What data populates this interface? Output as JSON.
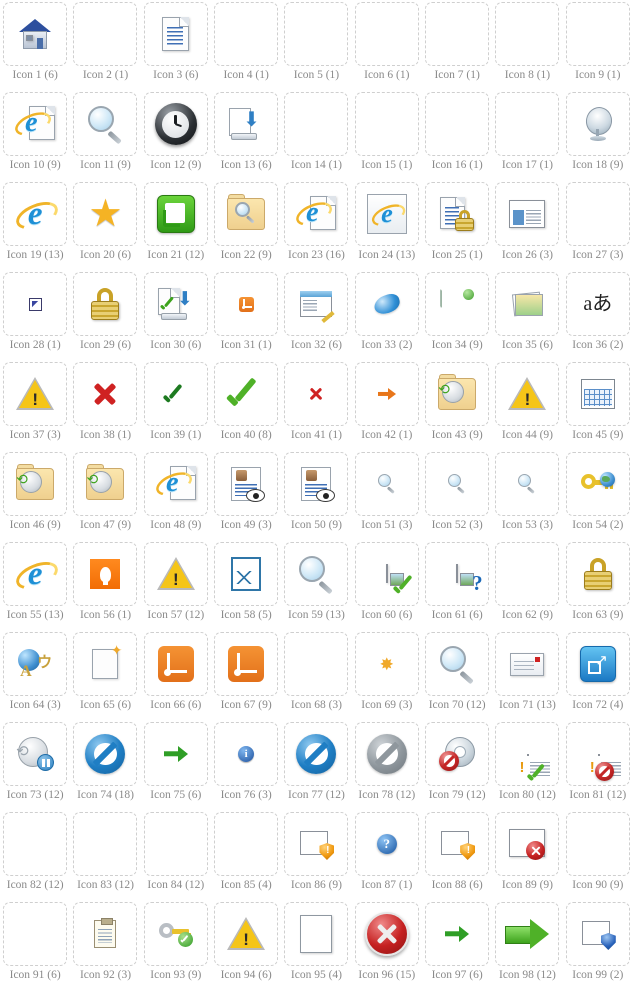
{
  "page": {
    "title": "Icon Grid",
    "columns": 9,
    "rows": 11,
    "total_cells": 99,
    "label_color": "#8a8a8a",
    "tile_border_color": "#cfcfcf",
    "background": "#ffffff"
  },
  "icons": [
    {
      "n": 1,
      "label": "Icon 1 (6)",
      "count": 6,
      "glyph": "house-icon",
      "empty": false
    },
    {
      "n": 2,
      "label": "Icon 2 (1)",
      "count": 1,
      "glyph": "empty",
      "empty": true
    },
    {
      "n": 3,
      "label": "Icon 3 (6)",
      "count": 6,
      "glyph": "document-icon",
      "empty": false
    },
    {
      "n": 4,
      "label": "Icon 4 (1)",
      "count": 1,
      "glyph": "empty",
      "empty": true
    },
    {
      "n": 5,
      "label": "Icon 5 (1)",
      "count": 1,
      "glyph": "empty",
      "empty": true
    },
    {
      "n": 6,
      "label": "Icon 6 (1)",
      "count": 1,
      "glyph": "empty",
      "empty": true
    },
    {
      "n": 7,
      "label": "Icon 7 (1)",
      "count": 1,
      "glyph": "empty",
      "empty": true
    },
    {
      "n": 8,
      "label": "Icon 8 (1)",
      "count": 1,
      "glyph": "empty",
      "empty": true
    },
    {
      "n": 9,
      "label": "Icon 9 (1)",
      "count": 1,
      "glyph": "empty",
      "empty": true
    },
    {
      "n": 10,
      "label": "Icon 10 (9)",
      "count": 9,
      "glyph": "ie-page-icon",
      "empty": false
    },
    {
      "n": 11,
      "label": "Icon 11 (9)",
      "count": 9,
      "glyph": "magnifier-icon",
      "empty": false
    },
    {
      "n": 12,
      "label": "Icon 12 (9)",
      "count": 9,
      "glyph": "dark-clock-icon",
      "empty": false
    },
    {
      "n": 13,
      "label": "Icon 13 (6)",
      "count": 6,
      "glyph": "download-drive-icon",
      "empty": false
    },
    {
      "n": 14,
      "label": "Icon 14 (1)",
      "count": 1,
      "glyph": "empty",
      "empty": true
    },
    {
      "n": 15,
      "label": "Icon 15 (1)",
      "count": 1,
      "glyph": "empty",
      "empty": true
    },
    {
      "n": 16,
      "label": "Icon 16 (1)",
      "count": 1,
      "glyph": "empty",
      "empty": true
    },
    {
      "n": 17,
      "label": "Icon 17 (1)",
      "count": 1,
      "glyph": "empty",
      "empty": true
    },
    {
      "n": 18,
      "label": "Icon 18 (9)",
      "count": 9,
      "glyph": "satellite-dish-icon",
      "empty": false
    },
    {
      "n": 19,
      "label": "Icon 19 (13)",
      "count": 13,
      "glyph": "ie-logo-icon",
      "empty": false
    },
    {
      "n": 20,
      "label": "Icon 20 (6)",
      "count": 6,
      "glyph": "star-icon",
      "empty": false
    },
    {
      "n": 21,
      "label": "Icon 21 (12)",
      "count": 12,
      "glyph": "green-rss-box-icon",
      "empty": false
    },
    {
      "n": 22,
      "label": "Icon 22 (9)",
      "count": 9,
      "glyph": "folder-search-icon",
      "empty": false
    },
    {
      "n": 23,
      "label": "Icon 23 (16)",
      "count": 16,
      "glyph": "ie-page-icon",
      "empty": false
    },
    {
      "n": 24,
      "label": "Icon 24 (13)",
      "count": 13,
      "glyph": "ie-framed-icon",
      "empty": false
    },
    {
      "n": 25,
      "label": "Icon 25 (1)",
      "count": 1,
      "glyph": "document-lock-icon",
      "empty": false
    },
    {
      "n": 26,
      "label": "Icon 26 (3)",
      "count": 3,
      "glyph": "window-pane-icon",
      "empty": false
    },
    {
      "n": 27,
      "label": "Icon 27 (3)",
      "count": 3,
      "glyph": "red-shield-question-icon",
      "empty": false
    },
    {
      "n": 28,
      "label": "Icon 28 (1)",
      "count": 1,
      "glyph": "tiny-square-icon",
      "empty": false
    },
    {
      "n": 29,
      "label": "Icon 29 (6)",
      "count": 6,
      "glyph": "padlock-icon",
      "empty": false
    },
    {
      "n": 30,
      "label": "Icon 30 (6)",
      "count": 6,
      "glyph": "document-download-check-icon",
      "empty": false
    },
    {
      "n": 31,
      "label": "Icon 31 (1)",
      "count": 1,
      "glyph": "rss-small-icon",
      "empty": false
    },
    {
      "n": 32,
      "label": "Icon 32 (6)",
      "count": 6,
      "glyph": "window-edit-icon",
      "empty": false
    },
    {
      "n": 33,
      "label": "Icon 33 (2)",
      "count": 2,
      "glyph": "blue-blob-icon",
      "empty": false
    },
    {
      "n": 34,
      "label": "Icon 34 (9)",
      "count": 9,
      "glyph": "map-pin-icon",
      "empty": false
    },
    {
      "n": 35,
      "label": "Icon 35 (6)",
      "count": 6,
      "glyph": "photo-stack-icon",
      "empty": false
    },
    {
      "n": 36,
      "label": "Icon 36 (2)",
      "count": 2,
      "glyph": "language-icon",
      "empty": false
    },
    {
      "n": 37,
      "label": "Icon 37 (3)",
      "count": 3,
      "glyph": "warning-triangle-icon",
      "empty": false
    },
    {
      "n": 38,
      "label": "Icon 38 (1)",
      "count": 1,
      "glyph": "red-x-icon",
      "empty": false
    },
    {
      "n": 39,
      "label": "Icon 39 (1)",
      "count": 1,
      "glyph": "dark-green-check-icon",
      "empty": false
    },
    {
      "n": 40,
      "label": "Icon 40 (8)",
      "count": 8,
      "glyph": "green-check-icon",
      "empty": false
    },
    {
      "n": 41,
      "label": "Icon 41 (1)",
      "count": 1,
      "glyph": "small-red-x-icon",
      "empty": false
    },
    {
      "n": 42,
      "label": "Icon 42 (1)",
      "count": 1,
      "glyph": "orange-arrow-icon",
      "empty": false
    },
    {
      "n": 43,
      "label": "Icon 43 (9)",
      "count": 9,
      "glyph": "folder-history-icon",
      "empty": false
    },
    {
      "n": 44,
      "label": "Icon 44 (9)",
      "count": 9,
      "glyph": "warning-triangle-icon",
      "empty": false
    },
    {
      "n": 45,
      "label": "Icon 45 (9)",
      "count": 9,
      "glyph": "calendar-icon",
      "empty": false
    },
    {
      "n": 46,
      "label": "Icon 46 (9)",
      "count": 9,
      "glyph": "folder-restore-icon",
      "empty": false
    },
    {
      "n": 47,
      "label": "Icon 47 (9)",
      "count": 9,
      "glyph": "folder-restore-icon",
      "empty": false
    },
    {
      "n": 48,
      "label": "Icon 48 (9)",
      "count": 9,
      "glyph": "ie-page-icon",
      "empty": false
    },
    {
      "n": 49,
      "label": "Icon 49 (3)",
      "count": 3,
      "glyph": "person-doc-eye-icon",
      "empty": false
    },
    {
      "n": 50,
      "label": "Icon 50 (9)",
      "count": 9,
      "glyph": "person-doc-eye-icon",
      "empty": false
    },
    {
      "n": 51,
      "label": "Icon 51 (3)",
      "count": 3,
      "glyph": "small-magnifier-icon",
      "empty": false
    },
    {
      "n": 52,
      "label": "Icon 52 (3)",
      "count": 3,
      "glyph": "small-magnifier-icon",
      "empty": false
    },
    {
      "n": 53,
      "label": "Icon 53 (3)",
      "count": 3,
      "glyph": "small-magnifier-icon",
      "empty": false
    },
    {
      "n": 54,
      "label": "Icon 54 (2)",
      "count": 2,
      "glyph": "key-globe-icon",
      "empty": false
    },
    {
      "n": 55,
      "label": "Icon 55 (13)",
      "count": 13,
      "glyph": "ie-logo-icon",
      "empty": false
    },
    {
      "n": 56,
      "label": "Icon 56 (1)",
      "count": 1,
      "glyph": "orange-bulb-icon",
      "empty": false
    },
    {
      "n": 57,
      "label": "Icon 57 (12)",
      "count": 12,
      "glyph": "warning-triangle-icon",
      "empty": false
    },
    {
      "n": 58,
      "label": "Icon 58 (5)",
      "count": 5,
      "glyph": "broken-image-icon",
      "empty": false
    },
    {
      "n": 59,
      "label": "Icon 59 (13)",
      "count": 13,
      "glyph": "magnifier-icon",
      "empty": false
    },
    {
      "n": 60,
      "label": "Icon 60 (6)",
      "count": 6,
      "glyph": "window-check-icon",
      "empty": false
    },
    {
      "n": 61,
      "label": "Icon 61 (6)",
      "count": 6,
      "glyph": "window-question-icon",
      "empty": false
    },
    {
      "n": 62,
      "label": "Icon 62 (9)",
      "count": 9,
      "glyph": "red-shield-x-icon",
      "empty": false
    },
    {
      "n": 63,
      "label": "Icon 63 (9)",
      "count": 9,
      "glyph": "padlock-icon",
      "empty": false
    },
    {
      "n": 64,
      "label": "Icon 64 (3)",
      "count": 3,
      "glyph": "globe-language-icon",
      "empty": false
    },
    {
      "n": 65,
      "label": "Icon 65 (6)",
      "count": 6,
      "glyph": "new-page-icon",
      "empty": false
    },
    {
      "n": 66,
      "label": "Icon 66 (6)",
      "count": 6,
      "glyph": "rss-icon",
      "empty": false
    },
    {
      "n": 67,
      "label": "Icon 67 (9)",
      "count": 9,
      "glyph": "rss-icon",
      "empty": false
    },
    {
      "n": 68,
      "label": "Icon 68 (3)",
      "count": 3,
      "glyph": "cascade-windows-icon",
      "empty": false
    },
    {
      "n": 69,
      "label": "Icon 69 (3)",
      "count": 3,
      "glyph": "spark-icon",
      "empty": false
    },
    {
      "n": 70,
      "label": "Icon 70 (12)",
      "count": 12,
      "glyph": "magnifier-icon",
      "empty": false
    },
    {
      "n": 71,
      "label": "Icon 71 (13)",
      "count": 13,
      "glyph": "envelope-icon",
      "empty": false
    },
    {
      "n": 72,
      "label": "Icon 72 (4)",
      "count": 4,
      "glyph": "blue-external-link-icon",
      "empty": false
    },
    {
      "n": 73,
      "label": "Icon 73 (12)",
      "count": 12,
      "glyph": "clock-pause-icon",
      "empty": false
    },
    {
      "n": 74,
      "label": "Icon 74 (18)",
      "count": 18,
      "glyph": "blue-ban-icon",
      "empty": false
    },
    {
      "n": 75,
      "label": "Icon 75 (6)",
      "count": 6,
      "glyph": "green-arrow-icon",
      "empty": false
    },
    {
      "n": 76,
      "label": "Icon 76 (3)",
      "count": 3,
      "glyph": "info-icon",
      "empty": false
    },
    {
      "n": 77,
      "label": "Icon 77 (12)",
      "count": 12,
      "glyph": "blue-ban-icon",
      "empty": false
    },
    {
      "n": 78,
      "label": "Icon 78 (12)",
      "count": 12,
      "glyph": "gray-ban-icon",
      "empty": false
    },
    {
      "n": 79,
      "label": "Icon 79 (12)",
      "count": 12,
      "glyph": "gear-ban-icon",
      "empty": false
    },
    {
      "n": 80,
      "label": "Icon 80 (12)",
      "count": 12,
      "glyph": "window-check-bang-icon",
      "empty": false
    },
    {
      "n": 81,
      "label": "Icon 81 (12)",
      "count": 12,
      "glyph": "window-ban-bang-icon",
      "empty": false
    },
    {
      "n": 82,
      "label": "Icon 82 (12)",
      "count": 12,
      "glyph": "orange-shield-bang-icon",
      "empty": false
    },
    {
      "n": 83,
      "label": "Icon 83 (12)",
      "count": 12,
      "glyph": "blue-shield-question-icon",
      "empty": false
    },
    {
      "n": 84,
      "label": "Icon 84 (12)",
      "count": 12,
      "glyph": "red-shield-x-icon",
      "empty": false
    },
    {
      "n": 85,
      "label": "Icon 85 (4)",
      "count": 4,
      "glyph": "green-shield-check-icon",
      "empty": false
    },
    {
      "n": 86,
      "label": "Icon 86 (9)",
      "count": 9,
      "glyph": "window-shield-bang-icon",
      "empty": false
    },
    {
      "n": 87,
      "label": "Icon 87 (1)",
      "count": 1,
      "glyph": "question-ball-icon",
      "empty": false
    },
    {
      "n": 88,
      "label": "Icon 88 (6)",
      "count": 6,
      "glyph": "window-shield-bang-icon",
      "empty": false
    },
    {
      "n": 89,
      "label": "Icon 89 (9)",
      "count": 9,
      "glyph": "window-error-icon",
      "empty": false
    },
    {
      "n": 90,
      "label": "Icon 90 (9)",
      "count": 9,
      "glyph": "multicolor-shield-icon",
      "empty": false
    },
    {
      "n": 91,
      "label": "Icon 91 (6)",
      "count": 6,
      "glyph": "green-shield-check-icon",
      "empty": false
    },
    {
      "n": 92,
      "label": "Icon 92 (3)",
      "count": 3,
      "glyph": "clipboard-icon",
      "empty": false
    },
    {
      "n": 93,
      "label": "Icon 93 (9)",
      "count": 9,
      "glyph": "key-check-icon",
      "empty": false
    },
    {
      "n": 94,
      "label": "Icon 94 (6)",
      "count": 6,
      "glyph": "warning-triangle-icon",
      "empty": false
    },
    {
      "n": 95,
      "label": "Icon 95 (4)",
      "count": 4,
      "glyph": "blank-page-icon",
      "empty": false
    },
    {
      "n": 96,
      "label": "Icon 96 (15)",
      "count": 15,
      "glyph": "red-circle-x-icon",
      "empty": false
    },
    {
      "n": 97,
      "label": "Icon 97 (6)",
      "count": 6,
      "glyph": "green-arrow-icon",
      "empty": false
    },
    {
      "n": 98,
      "label": "Icon 98 (12)",
      "count": 12,
      "glyph": "big-green-arrow-icon",
      "empty": false
    },
    {
      "n": 99,
      "label": "Icon 99 (2)",
      "count": 2,
      "glyph": "window-shield-icon",
      "empty": false
    }
  ]
}
